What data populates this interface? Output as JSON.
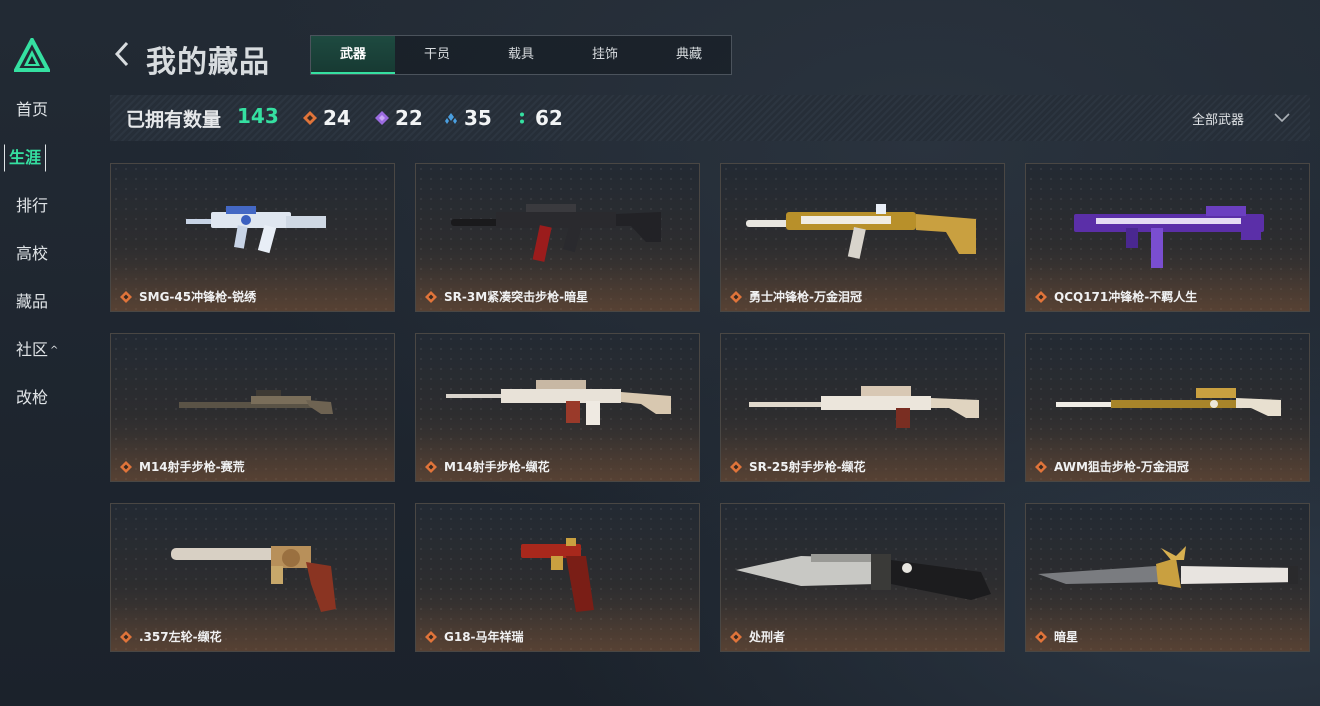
{
  "sidebar": {
    "items": [
      {
        "label": "首页",
        "active": false
      },
      {
        "label": "生涯",
        "active": true
      },
      {
        "label": "排行",
        "active": false
      },
      {
        "label": "高校",
        "active": false
      },
      {
        "label": "藏品",
        "active": false
      },
      {
        "label": "社区",
        "active": false,
        "caret": "^"
      },
      {
        "label": "改枪",
        "active": false
      }
    ]
  },
  "header": {
    "title": "我的藏品",
    "tabs": [
      "武器",
      "干员",
      "载具",
      "挂饰",
      "典藏"
    ],
    "active_tab": "武器"
  },
  "stats": {
    "owned_label": "已拥有数量",
    "owned_total": "143",
    "counts": [
      {
        "icon": "orange-diamond-icon",
        "color": "#e0743a",
        "value": "24"
      },
      {
        "icon": "purple-diamond-icon",
        "color": "#9b6be0",
        "value": "22"
      },
      {
        "icon": "blue-diamond-icon",
        "color": "#4a9fe0",
        "value": "35"
      },
      {
        "icon": "green-dots-icon",
        "color": "#35e0a1",
        "value": "62"
      }
    ],
    "filter_label": "全部武器"
  },
  "colors": {
    "accent": "#35e0a1",
    "rarity_orange": "#e0743a"
  },
  "items": [
    {
      "name": "SMG-45冲锋枪-锐绣",
      "kind": "smg-blue"
    },
    {
      "name": "SR-3M紧凑突击步枪-暗星",
      "kind": "rifle-dark"
    },
    {
      "name": "勇士冲锋枪-万金泪冠",
      "kind": "smg-gold"
    },
    {
      "name": "QCQ171冲锋枪-不羁人生",
      "kind": "smg-purple"
    },
    {
      "name": "M14射手步枪-赛荒",
      "kind": "dmr-camo"
    },
    {
      "name": "M14射手步枪-缬花",
      "kind": "dmr-white"
    },
    {
      "name": "SR-25射手步枪-缬花",
      "kind": "dmr-white2"
    },
    {
      "name": "AWM狙击步枪-万金泪冠",
      "kind": "sniper-gold"
    },
    {
      "name": ".357左轮-缬花",
      "kind": "revolver"
    },
    {
      "name": "G18-马年祥瑞",
      "kind": "pistol-red"
    },
    {
      "name": "处刑者",
      "kind": "knife-dark"
    },
    {
      "name": "暗星",
      "kind": "knife-gold"
    }
  ]
}
